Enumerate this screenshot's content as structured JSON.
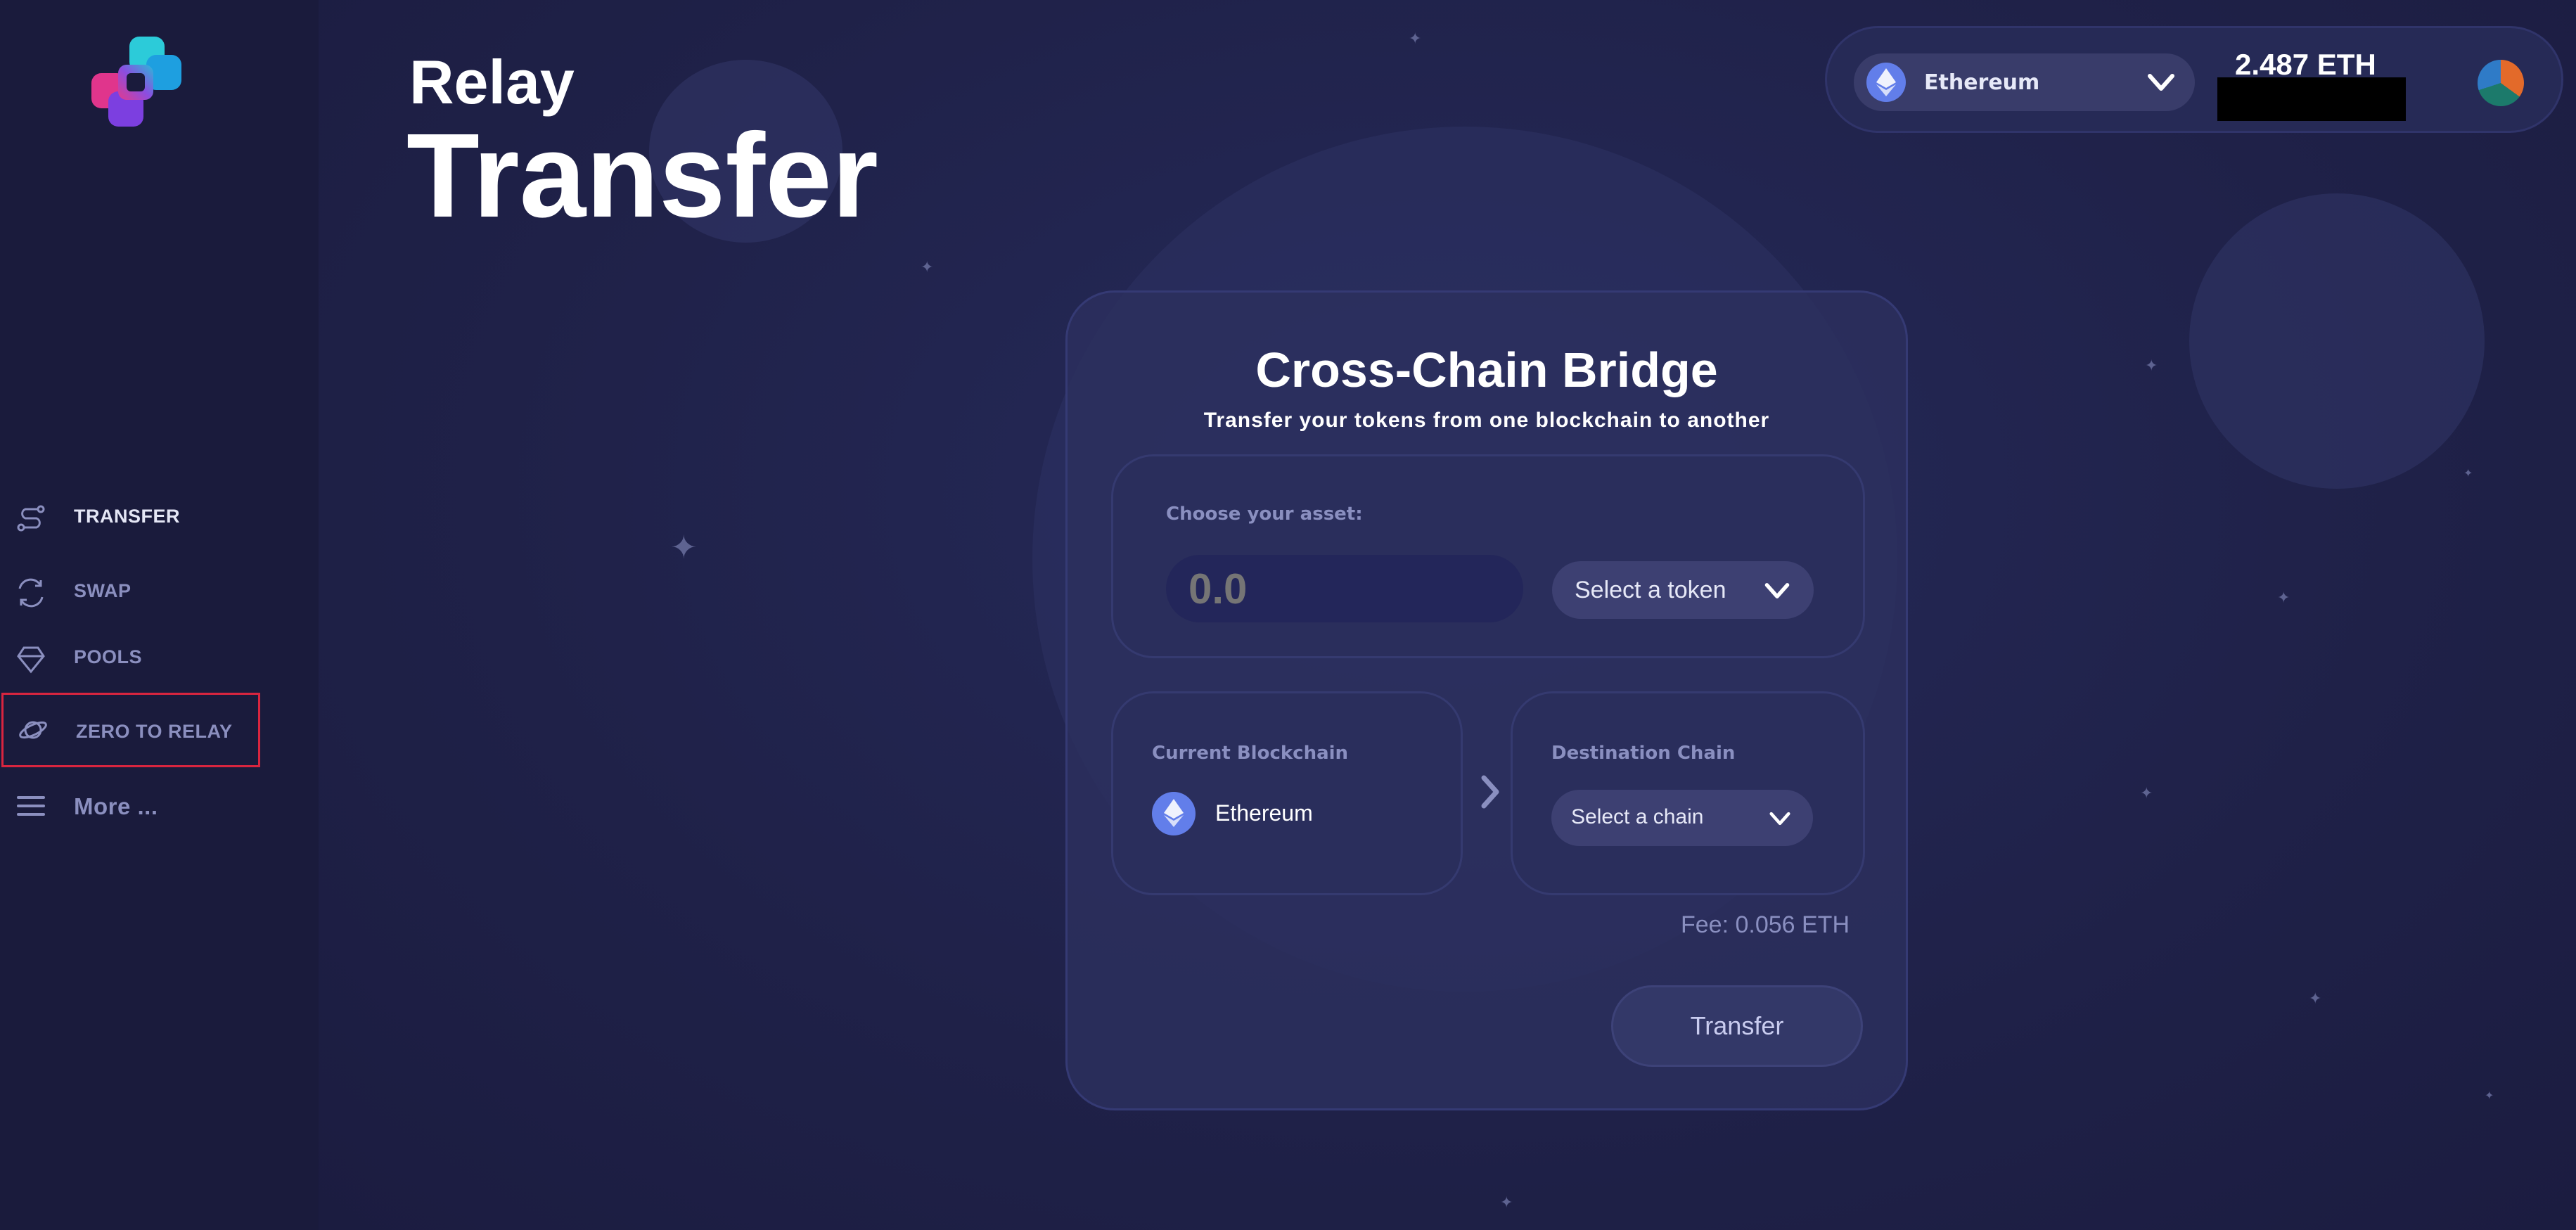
{
  "sidebar": {
    "logo": "relay-logo",
    "items": [
      {
        "label": "TRANSFER",
        "icon": "route-icon"
      },
      {
        "label": "SWAP",
        "icon": "swap-icon"
      },
      {
        "label": "POOLS",
        "icon": "gem-icon"
      },
      {
        "label": "ZERO TO RELAY",
        "icon": "planet-icon"
      },
      {
        "label": "More ...",
        "icon": "menu-icon"
      }
    ]
  },
  "header": {
    "brand": "Relay",
    "page_title": "Transfer"
  },
  "wallet": {
    "network": "Ethereum",
    "network_icon": "ethereum-icon",
    "balance": "2.487 ETH"
  },
  "bridge": {
    "title": "Cross-Chain Bridge",
    "subtitle": "Transfer your tokens from one blockchain to another",
    "asset_label": "Choose your asset:",
    "amount_placeholder": "0.0",
    "token_select_label": "Select a token",
    "current_chain_label": "Current Blockchain",
    "current_chain": "Ethereum",
    "destination_label": "Destination Chain",
    "destination_select_label": "Select a chain",
    "fee": "Fee: 0.056 ETH",
    "transfer_button": "Transfer"
  },
  "colors": {
    "background": "#1f2148",
    "sidebar": "#1a1b3c",
    "card": "#2c305e",
    "accent_eth": "#627eea",
    "muted_text": "#8a8fc0",
    "highlight_border": "#d9253f"
  }
}
